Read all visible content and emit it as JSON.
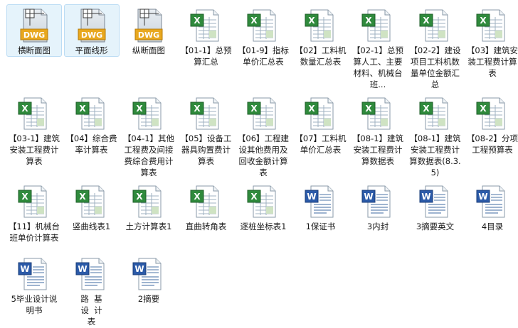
{
  "items": [
    {
      "label": "横断面图",
      "type": "dwg",
      "selected": true
    },
    {
      "label": "平面线形",
      "type": "dwg",
      "selected": true
    },
    {
      "label": "纵断面图",
      "type": "dwg",
      "selected": false
    },
    {
      "label": "【01-1】总预算汇总",
      "type": "xls",
      "selected": false
    },
    {
      "label": "【01-9】指标单价汇总表",
      "type": "xls",
      "selected": false
    },
    {
      "label": "【02】工料机数量汇总表",
      "type": "xls",
      "selected": false
    },
    {
      "label": "【02-1】总预算人工、主要材料、机械台班...",
      "type": "xls",
      "selected": false
    },
    {
      "label": "【02-2】建设项目工料机数量单位金额汇总",
      "type": "xls",
      "selected": false
    },
    {
      "label": "【03】建筑安装工程费计算表",
      "type": "xls",
      "selected": false
    },
    {
      "label": "【03-1】建筑安装工程费计算表",
      "type": "xls",
      "selected": false
    },
    {
      "label": "【04】综合费率计算表",
      "type": "xls",
      "selected": false
    },
    {
      "label": "【04-1】其他工程费及间接费综合费用计算表",
      "type": "xls",
      "selected": false
    },
    {
      "label": "【05】设备工器具购置费计算表",
      "type": "xls",
      "selected": false
    },
    {
      "label": "【06】工程建设其他费用及回收金额计算表",
      "type": "xls",
      "selected": false
    },
    {
      "label": "【07】工料机单价汇总表",
      "type": "xls",
      "selected": false
    },
    {
      "label": "【08-1】建筑安装工程费计算数据表",
      "type": "xls",
      "selected": false
    },
    {
      "label": "【08-1】建筑安装工程费计算数据表(8.3.5)",
      "type": "xls",
      "selected": false
    },
    {
      "label": "【08-2】分项工程预算表",
      "type": "xls",
      "selected": false
    },
    {
      "label": "【11】机械台班单价计算表",
      "type": "xls",
      "selected": false
    },
    {
      "label": "竖曲线表1",
      "type": "xls",
      "selected": false
    },
    {
      "label": "土方计算表1",
      "type": "xls",
      "selected": false
    },
    {
      "label": "直曲转角表",
      "type": "xls",
      "selected": false
    },
    {
      "label": "逐桩坐标表1",
      "type": "xls",
      "selected": false
    },
    {
      "label": "1保证书",
      "type": "doc",
      "selected": false
    },
    {
      "label": "3内封",
      "type": "doc",
      "selected": false
    },
    {
      "label": "3摘要英文",
      "type": "doc",
      "selected": false
    },
    {
      "label": "4目录",
      "type": "doc",
      "selected": false
    },
    {
      "label": "5毕业设计说明书",
      "type": "doc",
      "selected": false
    },
    {
      "label": "路  基\n设  计\n表",
      "type": "doc",
      "selected": false
    },
    {
      "label": "2摘要",
      "type": "doc",
      "selected": false
    }
  ]
}
